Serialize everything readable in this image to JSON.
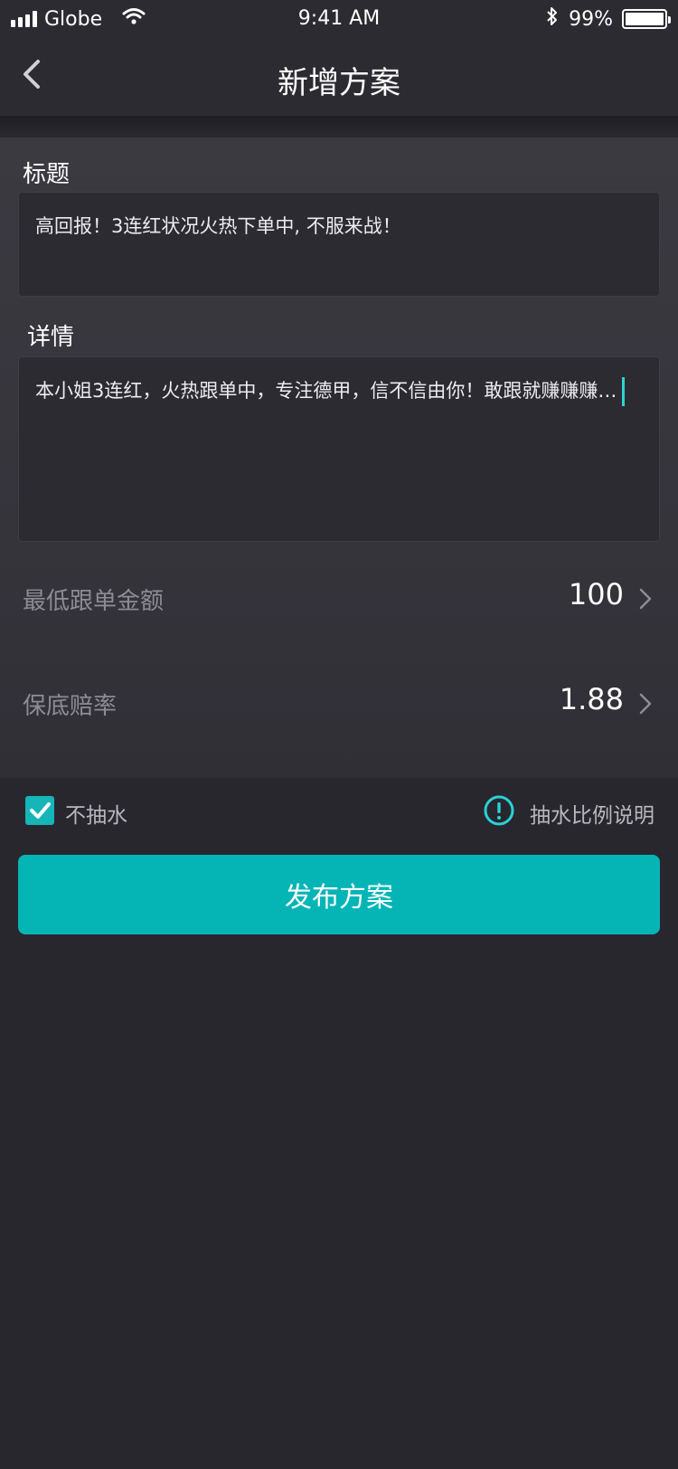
{
  "status_bar": {
    "carrier": "Globe",
    "time": "9:41 AM",
    "battery": "99%",
    "battery_level": 0.99,
    "icons": [
      "signal-icon",
      "wifi-icon",
      "bluetooth-icon",
      "battery-icon"
    ]
  },
  "nav": {
    "title": "新增方案",
    "back_icon": "chevron-left-icon"
  },
  "form": {
    "title_label": "标题",
    "title_value": "高回报！3连红状况火热下单中, 不服来战！",
    "detail_label": "详情",
    "detail_value": "本小姐3连红，火热跟单中，专注德甲，信不信由你！敢跟就赚赚赚…",
    "min_amount_label": "最低跟单金额",
    "min_amount_value": "100",
    "guarantee_label": "保底赔率",
    "guarantee_value": "1.88"
  },
  "options": {
    "no_fee_label": "不抽水",
    "no_fee_checked": true,
    "fee_info_label": "抽水比例说明"
  },
  "actions": {
    "publish_label": "发布方案"
  },
  "colors": {
    "accent": "#05b5b6",
    "background": "#28272e",
    "caret": "#29d4d4"
  }
}
